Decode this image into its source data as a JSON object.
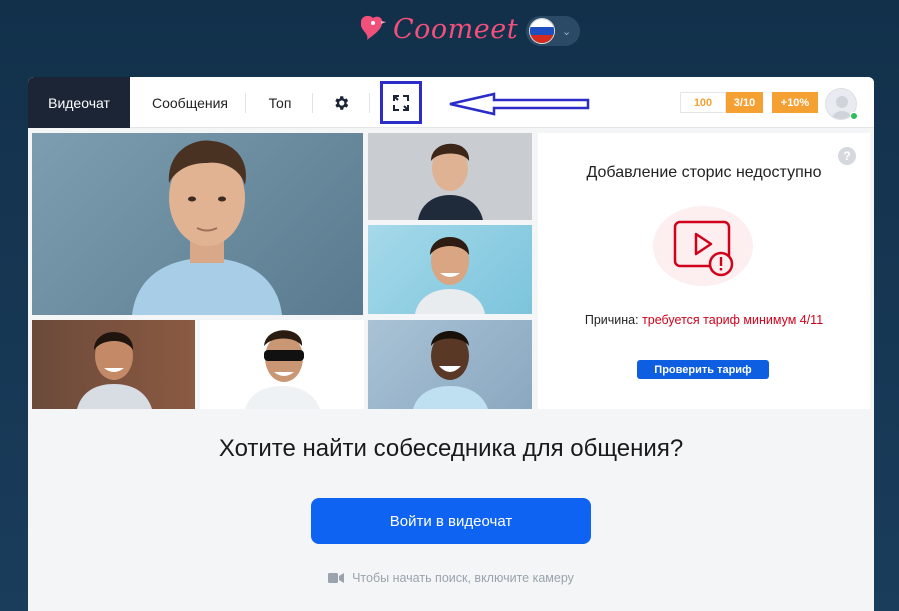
{
  "header": {
    "logo_text": "Coomeet",
    "language_flag": "ru-flag-icon"
  },
  "nav": {
    "videochat": "Видеочат",
    "messages": "Сообщения",
    "top": "Топ",
    "settings_icon": "gear-icon",
    "fullscreen_icon": "fullscreen-icon"
  },
  "balance": {
    "coins": "100",
    "tariff": "3/10",
    "bonus": "+10%"
  },
  "stories": {
    "title": "Добавление сторис недоступно",
    "reason_label": "Причина:",
    "reason_text": "требуется тариф минимум 4/11",
    "button": "Проверить тариф"
  },
  "main": {
    "question": "Хотите найти собеседника для общения?",
    "enter_button": "Войти в видеочат",
    "hint": "Чтобы начать поиск, включите камеру"
  },
  "colors": {
    "brand_pink": "#f0507a",
    "accent_blue": "#0f63f2",
    "warning_red": "#d0021b",
    "tariff_orange": "#f5a033",
    "annotation_blue": "#2c2cc8"
  }
}
